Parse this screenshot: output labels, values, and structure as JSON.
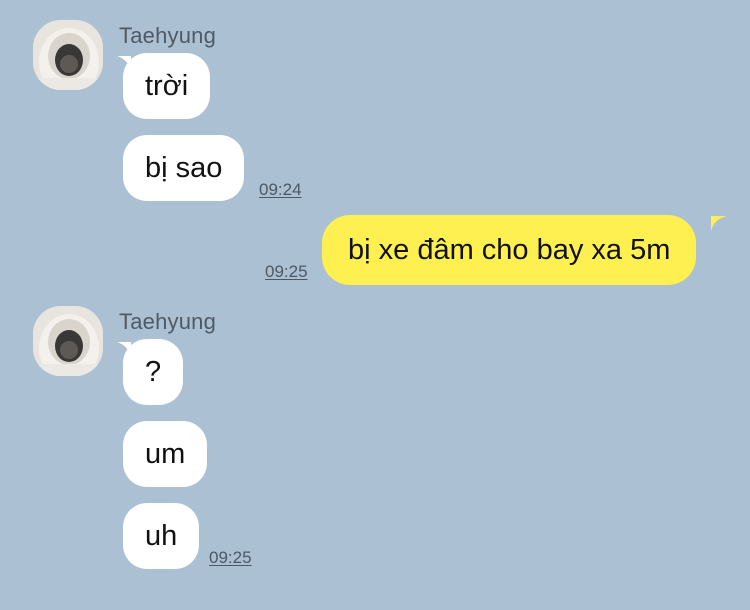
{
  "groups": [
    {
      "sender": "Taehyung",
      "messages": [
        {
          "text": "trời"
        },
        {
          "text": "bị sao",
          "time": "09:24"
        }
      ]
    },
    {
      "sender": "Taehyung",
      "messages": [
        {
          "text": "?"
        },
        {
          "text": "um"
        },
        {
          "text": "uh",
          "time": "09:25"
        }
      ]
    }
  ],
  "outgoing": {
    "text": "bị xe đâm cho bay xa 5m",
    "time": "09:25"
  },
  "colors": {
    "background": "#abc0d3",
    "incoming_bubble": "#ffffff",
    "outgoing_bubble": "#fdf050"
  }
}
